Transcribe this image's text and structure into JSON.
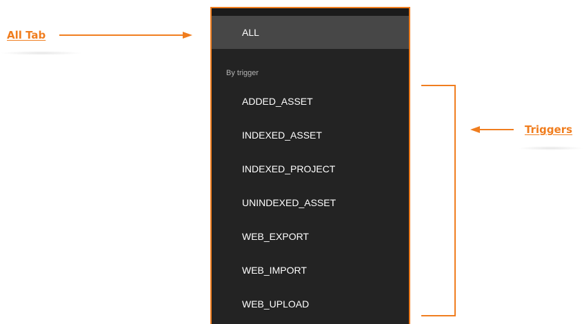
{
  "annotations": {
    "all_tab_label": "All Tab",
    "triggers_label": "Triggers",
    "accent_color": "#f07d1e"
  },
  "menu": {
    "all_label": "ALL",
    "section_label": "By trigger",
    "items": [
      {
        "label": "ADDED_ASSET"
      },
      {
        "label": "INDEXED_ASSET"
      },
      {
        "label": "INDEXED_PROJECT"
      },
      {
        "label": "UNINDEXED_ASSET"
      },
      {
        "label": "WEB_EXPORT"
      },
      {
        "label": "WEB_IMPORT"
      },
      {
        "label": "WEB_UPLOAD"
      }
    ],
    "background_color": "#232323",
    "selected_background_color": "#474747"
  }
}
